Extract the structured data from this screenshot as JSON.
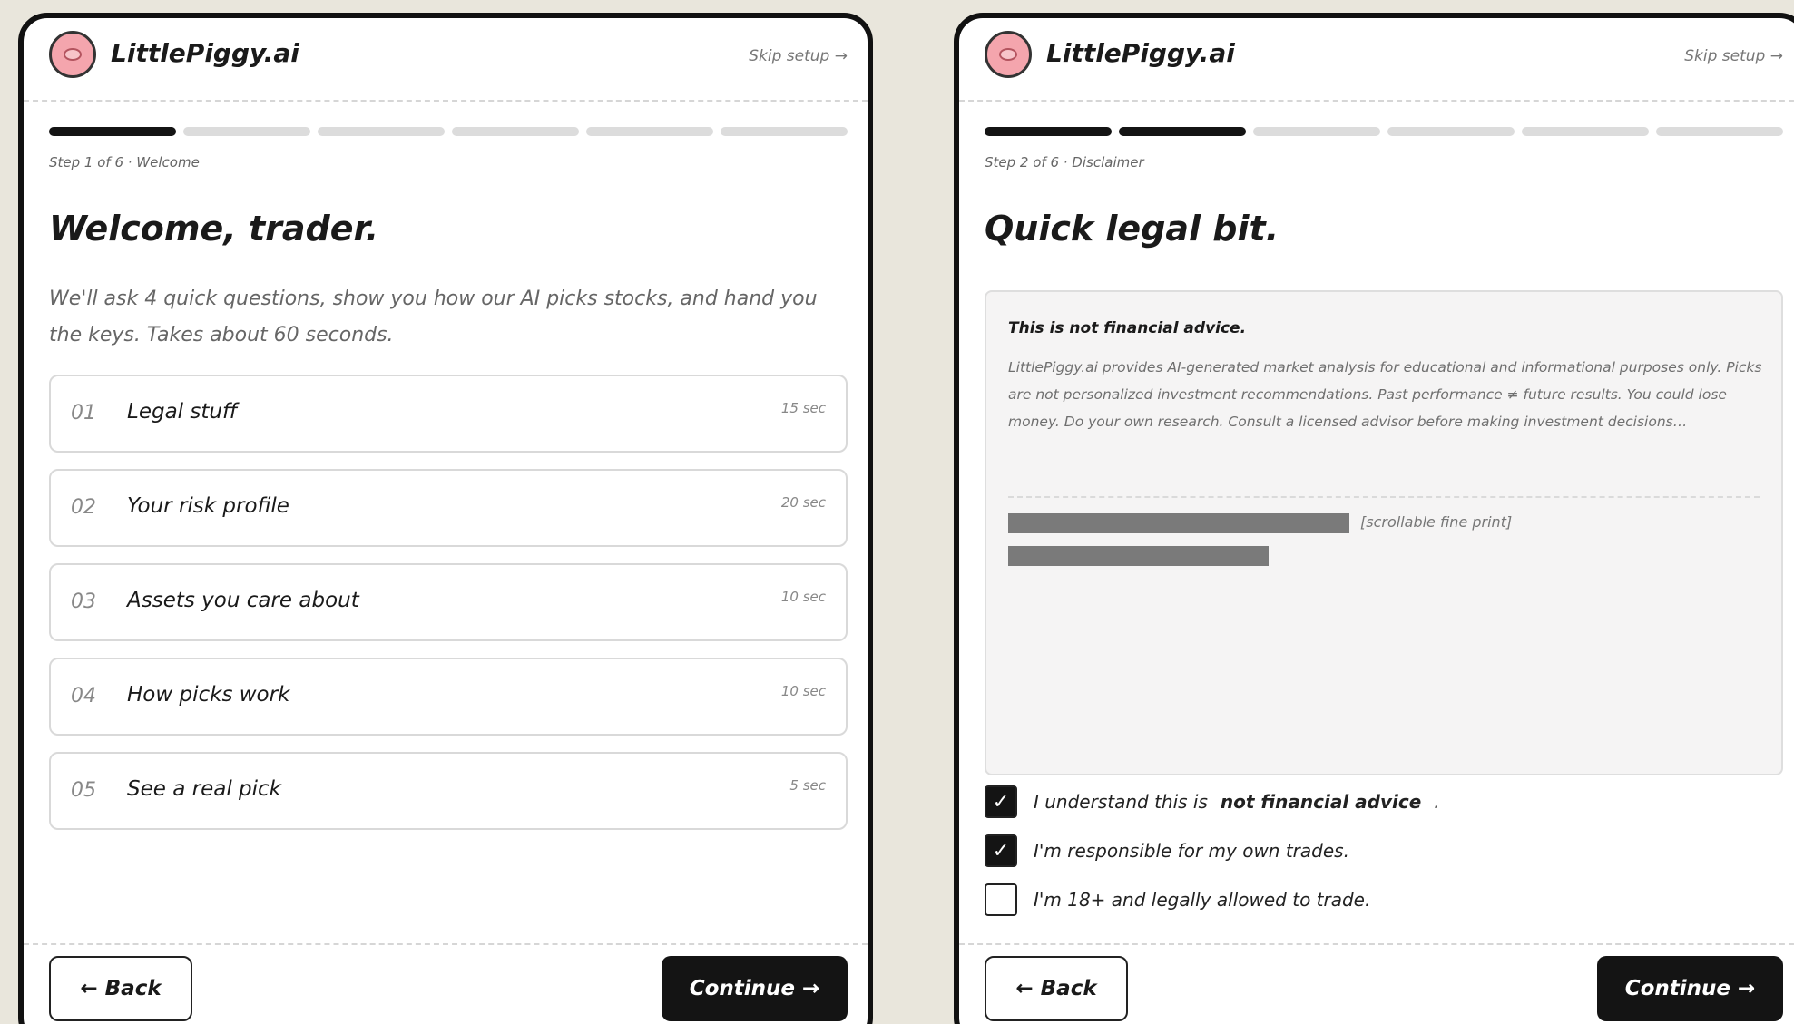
{
  "left": {
    "brand": "LittlePiggy.ai",
    "skip": "Skip setup →",
    "progress_total": 6,
    "progress_done": 1,
    "step_label": "Step 1 of 6 · Welcome",
    "title": "Welcome, trader.",
    "intro": "We'll ask 4 quick questions, show you how our AI picks stocks, and hand you the keys. Takes about 60 seconds.",
    "steps": [
      {
        "num": "01",
        "label": "Legal stuff",
        "time": "15 sec"
      },
      {
        "num": "02",
        "label": "Your risk profile",
        "time": "20 sec"
      },
      {
        "num": "03",
        "label": "Assets you care about",
        "time": "10 sec"
      },
      {
        "num": "04",
        "label": "How picks work",
        "time": "10 sec"
      },
      {
        "num": "05",
        "label": "See a real pick",
        "time": "5 sec"
      }
    ],
    "back": "← Back",
    "continue": "Continue →"
  },
  "right": {
    "brand": "LittlePiggy.ai",
    "skip": "Skip setup →",
    "progress_total": 6,
    "progress_done": 2,
    "step_label": "Step 2 of 6 · Disclaimer",
    "title": "Quick legal bit.",
    "legal_heading": "This is not financial advice.",
    "legal_body": "LittlePiggy.ai provides AI-generated market analysis for educational and informational purposes only. Picks are not personalized investment recommendations. Past performance ≠ future results. You could lose money. Do your own research. Consult a licensed advisor before making investment decisions…",
    "fine_print_note": "[scrollable fine print]",
    "checks": [
      {
        "pre": "I understand this is",
        "bold": "not financial advice",
        "post": ".",
        "checked": true
      },
      {
        "pre": "I'm responsible for my own trades.",
        "bold": "",
        "post": "",
        "checked": true
      },
      {
        "pre": "I'm 18+ and legally allowed to trade.",
        "bold": "",
        "post": "",
        "checked": false
      }
    ],
    "back": "← Back",
    "continue": "Continue →"
  }
}
